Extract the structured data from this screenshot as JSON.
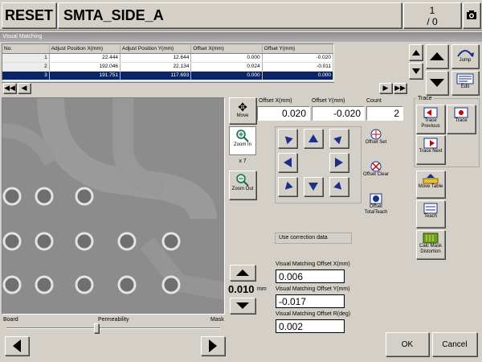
{
  "header": {
    "reset_label": "RESET",
    "program_name": "SMTA_SIDE_A",
    "counter_top": "1",
    "counter_bottom": "/ 0"
  },
  "panel_title": "Visual Matching",
  "grid": {
    "columns": [
      "No.",
      "Adjust Position X(mm)",
      "Adjust Position Y(mm)",
      "Offset X(mm)",
      "Offset Y(mm)"
    ],
    "rows": [
      {
        "no": "1",
        "adj_x": "22.444",
        "adj_y": "12.644",
        "off_x": "0.000",
        "off_y": "-0.020"
      },
      {
        "no": "2",
        "adj_x": "192.046",
        "adj_y": "22.134",
        "off_x": "0.024",
        "off_y": "-0.011"
      },
      {
        "no": "3",
        "adj_x": "191.751",
        "adj_y": "117.693",
        "off_x": "0.000",
        "off_y": "0.000"
      }
    ],
    "selected_row": 3
  },
  "side_buttons": {
    "jump": "Jump",
    "edit": "Edit"
  },
  "view_controls": {
    "move": "Move",
    "zoom_in": "Zoom In",
    "zoom_level": "x 7",
    "zoom_out": "Zoom Out"
  },
  "offset_display": {
    "x_label": "Offset X(mm)",
    "y_label": "Offset Y(mm)",
    "count_label": "Count",
    "x_value": "0.020",
    "y_value": "-0.020",
    "count_value": "2"
  },
  "offset_buttons": {
    "set": "Offset Set",
    "clear": "Offset Clear",
    "total_teach": "Offset TotalTeach"
  },
  "trace": {
    "group_label": "Trace",
    "previous": "Trace Previous",
    "trace": "Trace",
    "next": "Trace Next"
  },
  "tools": {
    "move_table": "Move Table",
    "teach": "Teach",
    "calc_mask": "Calc Mask Distortion"
  },
  "correction_label": "Use correction data",
  "step": {
    "value": "0.010",
    "unit": "mm"
  },
  "matching_offsets": {
    "x_label": "Visual Matching Offset X(mm)",
    "x_value": "0.006",
    "y_label": "Visual Matching Offset Y(mm)",
    "y_value": "-0.017",
    "r_label": "Visual Matching Offset R(deg)",
    "r_value": "0.002"
  },
  "permeability": {
    "left": "Board",
    "center": "Permeability",
    "right": "Mask",
    "level": 0.42
  },
  "footer": {
    "ok": "OK",
    "cancel": "Cancel"
  },
  "colors": {
    "selection": "#0a246a",
    "arrow": "#1a2f8a",
    "panel": "#d4d0c8"
  }
}
